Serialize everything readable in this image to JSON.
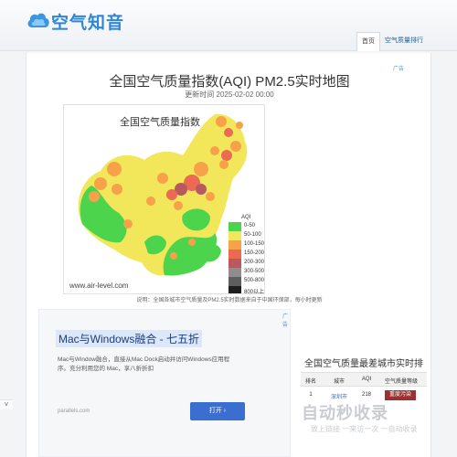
{
  "header": {
    "logo_text": "空气知音",
    "tabs": [
      {
        "label": "首页"
      },
      {
        "label": "空气质量排行榜"
      }
    ]
  },
  "main": {
    "title": "全国空气质量指数(AQI) PM2.5实时地图",
    "update_time": "更新时间 2025-02-02 00:00",
    "ad_tag": "广告",
    "map": {
      "title": "全国空气质量指数",
      "url": "www.air-level.com",
      "legend_title": "AQI",
      "legend": [
        {
          "label": "0-50",
          "color": "#4cd44c"
        },
        {
          "label": "50-100",
          "color": "#f2e65a"
        },
        {
          "label": "100-150",
          "color": "#f7a24a"
        },
        {
          "label": "150-200",
          "color": "#ec6a52"
        },
        {
          "label": "200-300",
          "color": "#b8595f"
        },
        {
          "label": "300-500",
          "color": "#8e8e8e"
        },
        {
          "label": "500-800",
          "color": "#5e5e5e"
        },
        {
          "label": "800以上",
          "color": "#1e1e1e"
        }
      ]
    },
    "caption": "说明：全国各城市空气质量及PM2.5实时数据来自于中国环保部，每小时更新"
  },
  "ad_block": {
    "tag": "广告",
    "headline": "Mac与Windows融合 - 七五折",
    "description": "Mac与Window融合，直接从Mac Dock启动并访问Windows应用程序。充分利用您的 Mac，享八折折扣",
    "domain": "parallels.com",
    "button": "打开 ›"
  },
  "ranking": {
    "title": "全国空气质量最差城市实时排名",
    "columns": [
      "排名",
      "城市",
      "AQI",
      "空气质量等级"
    ],
    "rows": [
      {
        "rank": "1",
        "city": "深圳市",
        "aqi": "218",
        "level": "重度污染"
      }
    ]
  },
  "watermark": {
    "logo": "自动秒收录",
    "sub": "致上链接 一来访一次 一自动收录"
  },
  "scroll_toggle": "˅"
}
